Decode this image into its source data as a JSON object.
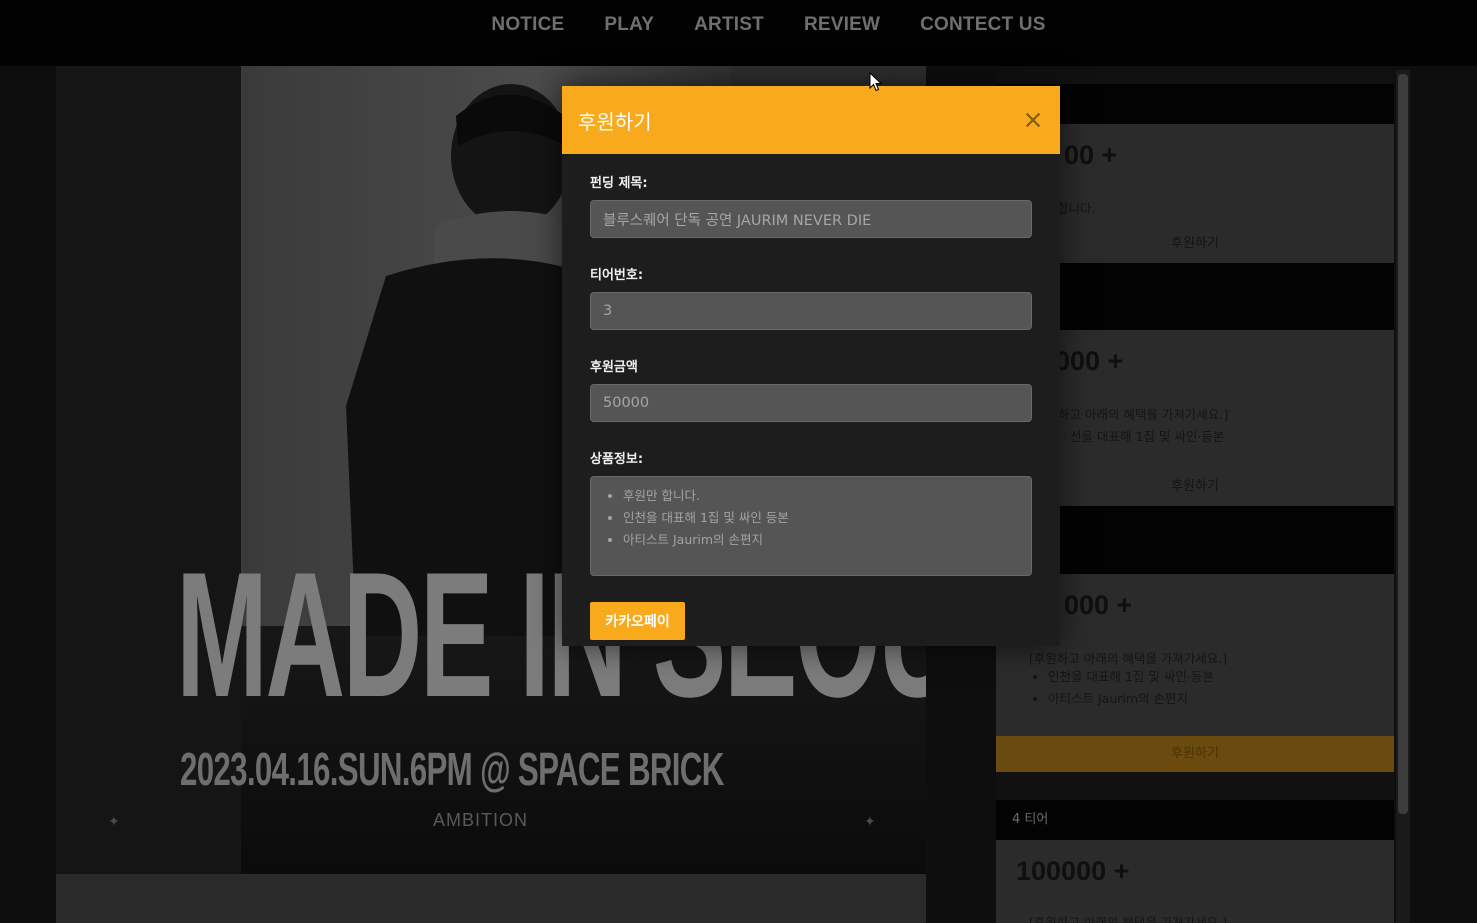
{
  "nav": {
    "items": [
      {
        "label": "NOTICE"
      },
      {
        "label": "PLAY"
      },
      {
        "label": "ARTIST"
      },
      {
        "label": "REVIEW"
      },
      {
        "label": "CONTECT US"
      }
    ]
  },
  "poster": {
    "headline": "MADE IN SEOUL",
    "date_line": "2023.04.16.SUN.6PM @ SPACE BRICK",
    "brand": "AMBITION"
  },
  "tiers": {
    "card1": {
      "amount_partial": "00 +",
      "text_partial": "합니다.",
      "button": "후원하기"
    },
    "card2": {
      "amount_partial": "000 +",
      "text1_partial": "하고 아래의 혜택을 가져가세요.]",
      "text2_partial": "선을 대표해 1집 및 싸인·등본",
      "button": "후원하기"
    },
    "card3": {
      "amount_partial": "000 +",
      "intro": "[후원하고 아래의 혜택을 가져가세요.]",
      "benefits": [
        "인천을 대표해 1집 및 싸인·등본",
        "아티스트 Jaurim의 손편지"
      ],
      "button": "후원하기"
    },
    "tier4": {
      "header": "4 티어",
      "amount": "100000 +",
      "text_partial": "[후원하고 아래의 혜택을 가져가세요.]"
    }
  },
  "modal": {
    "title": "후원하기",
    "fields": {
      "funding_title": {
        "label": "펀딩 제목:",
        "value": "블루스퀘어 단독 공연 JAURIM NEVER DIE"
      },
      "tier_number": {
        "label": "티어번호:",
        "value": "3"
      },
      "amount": {
        "label": "후원금액",
        "value": "50000"
      },
      "product_info": {
        "label": "상품정보:",
        "items": [
          "후원만 합니다.",
          "인천을 대표해 1집 및 싸인 등본",
          "아티스트 Jaurim의 손편지"
        ]
      }
    },
    "pay_button": "카카오페이",
    "colors": {
      "accent": "#f9a91c",
      "body": "#1d1d1d",
      "input": "#555555"
    }
  }
}
